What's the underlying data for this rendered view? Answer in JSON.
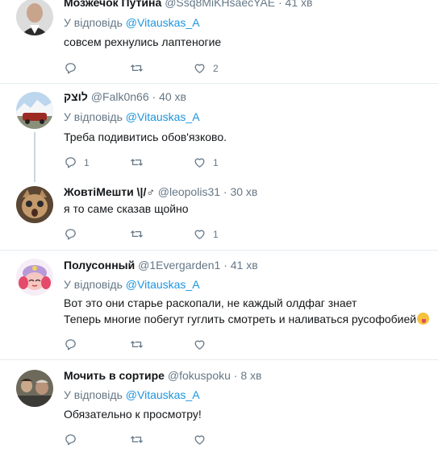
{
  "tweets": [
    {
      "name": "Мозжечок Путина",
      "handle": "@Ssq8MiKHsaecYAE",
      "dot": "·",
      "time": "41 хв",
      "reply_prefix": "У відповідь",
      "reply_to": "@Vitauskas_A",
      "text": "совсем рехнулись лаптеногие",
      "reply_count": "",
      "retweet_count": "",
      "like_count": "2"
    },
    {
      "name": "לוצק",
      "handle": "@Falk0n66",
      "dot": "·",
      "time": "40 хв",
      "reply_prefix": "У відповідь",
      "reply_to": "@Vitauskas_A",
      "text": "Треба подивитись обов'язково.",
      "reply_count": "1",
      "retweet_count": "",
      "like_count": "1"
    },
    {
      "name": "ЖовтіМешти \\|/♂",
      "handle": "@leopolis31",
      "dot": "·",
      "time": "30 хв",
      "text": "я то саме сказав щойно",
      "reply_count": "",
      "retweet_count": "",
      "like_count": "1"
    },
    {
      "name": "Полусонный",
      "handle": "@1Evergarden1",
      "dot": "·",
      "time": "41 хв",
      "reply_prefix": "У відповідь",
      "reply_to": "@Vitauskas_A",
      "text_line1": "Вот это они старье раскопали, не каждый олдфаг знает",
      "text_line2": "Теперь многие побегут гуглить смотреть и наливаться русофобией",
      "reply_count": "",
      "retweet_count": "",
      "like_count": ""
    },
    {
      "name": "Мочить в сортире",
      "handle": "@fokuspoku",
      "dot": "·",
      "time": "8 хв",
      "reply_prefix": "У відповідь",
      "reply_to": "@Vitauskas_A",
      "text": "Обязательно к просмотру!",
      "reply_count": "",
      "retweet_count": "",
      "like_count": ""
    }
  ],
  "icons": {
    "reply": "reply-icon",
    "retweet": "retweet-icon",
    "like": "heart-icon",
    "emoji": "tongue-wink-emoji-icon"
  },
  "colors": {
    "link": "#1b95e0",
    "muted": "#657786",
    "text": "#14171a",
    "separator": "#e6ecf0",
    "thread_line": "#ccd6dd"
  }
}
